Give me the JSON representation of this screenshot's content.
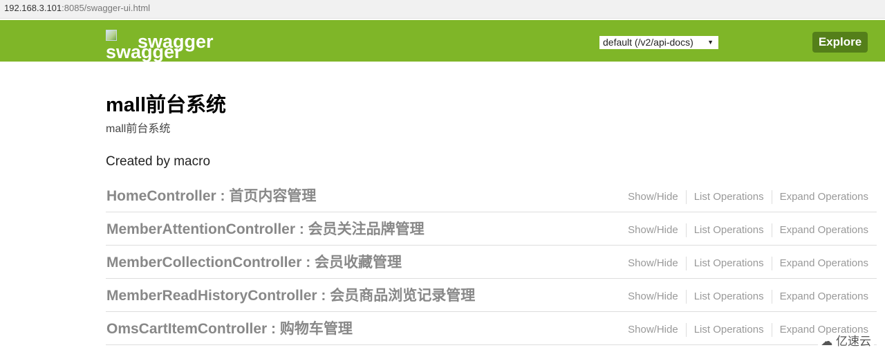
{
  "browser": {
    "url_host": "192.168.3.101",
    "url_rest": ":8085/swagger-ui.html"
  },
  "header": {
    "logo_alt": "swagger",
    "api_select_value": "default (/v2/api-docs)",
    "explore_label": "Explore",
    "colors": {
      "bar": "#7fb628",
      "button": "#547f1a"
    }
  },
  "info": {
    "title": "mall前台系统",
    "description": "mall前台系统",
    "created_by": "Created by macro"
  },
  "resources": [
    {
      "name": "HomeController : 首页内容管理",
      "ops": [
        "Show/Hide",
        "List Operations",
        "Expand Operations"
      ]
    },
    {
      "name": "MemberAttentionController : 会员关注品牌管理",
      "ops": [
        "Show/Hide",
        "List Operations",
        "Expand Operations"
      ]
    },
    {
      "name": "MemberCollectionController : 会员收藏管理",
      "ops": [
        "Show/Hide",
        "List Operations",
        "Expand Operations"
      ]
    },
    {
      "name": "MemberReadHistoryController : 会员商品浏览记录管理",
      "ops": [
        "Show/Hide",
        "List Operations",
        "Expand Operations"
      ]
    },
    {
      "name": "OmsCartItemController : 购物车管理",
      "ops": [
        "Show/Hide",
        "List Operations",
        "Expand Operations"
      ]
    }
  ],
  "watermark": "亿速云"
}
